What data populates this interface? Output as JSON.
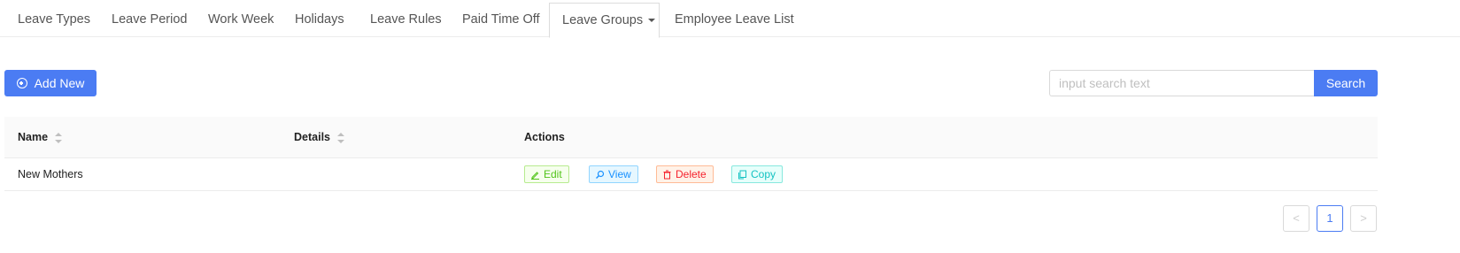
{
  "tabs": [
    {
      "label": "Leave Types"
    },
    {
      "label": "Leave Period"
    },
    {
      "label": "Work Week"
    },
    {
      "label": "Holidays"
    },
    {
      "label": "Leave Rules"
    },
    {
      "label": "Paid Time Off"
    },
    {
      "label": "Leave Groups",
      "active": true
    },
    {
      "label": "Employee Leave List"
    }
  ],
  "toolbar": {
    "add_label": "Add New",
    "search_placeholder": "input search text",
    "search_value": "",
    "search_label": "Search"
  },
  "table": {
    "columns": [
      "Name",
      "Details",
      "Actions"
    ],
    "rows": [
      {
        "name": "New Mothers",
        "details": ""
      }
    ],
    "actions": {
      "edit": "Edit",
      "view": "View",
      "delete": "Delete",
      "copy": "Copy"
    }
  },
  "pagination": {
    "prev": "<",
    "current": "1",
    "next": ">"
  },
  "colors": {
    "primary": "#4b7cf3",
    "edit": "#52c41a",
    "view": "#1890ff",
    "delete": "#f5222d",
    "copy": "#13c2c2"
  }
}
